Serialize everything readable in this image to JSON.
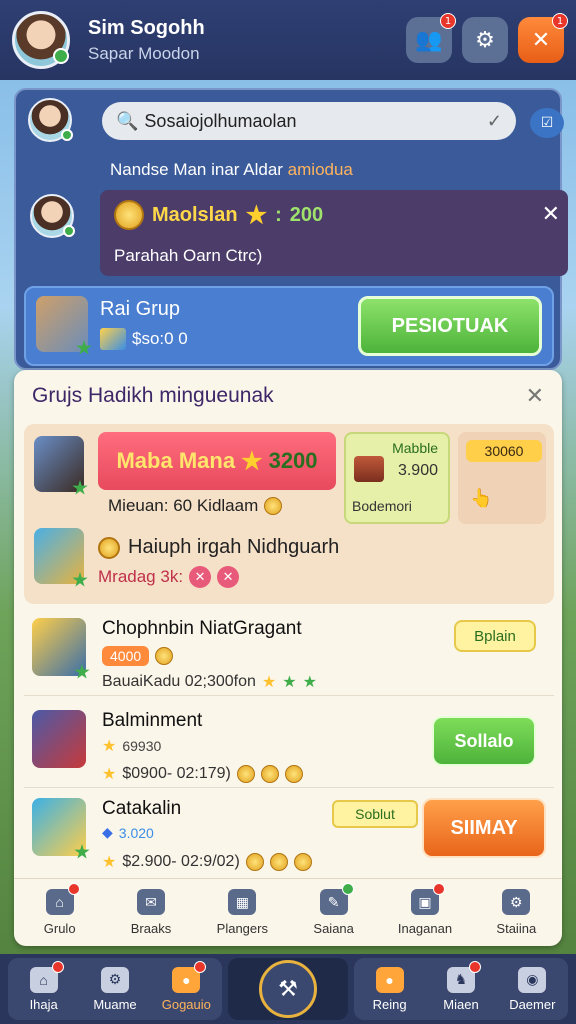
{
  "header": {
    "name": "Sim Sogohh",
    "subtitle": "Sapar Moodon"
  },
  "panel1": {
    "search_text": "Sosaiojolhumaolan",
    "hint_text": "Nandse Man inar Aldar",
    "hint_highlight": "amiodua",
    "promo": {
      "title": "Maolslan",
      "amount": "200",
      "amount_prefix": ":",
      "subtitle": "Parahah Oarn Ctrc)"
    },
    "group": {
      "title": "Rai Grup",
      "stat": "$so:0 0",
      "button": "PESIOTUAK"
    }
  },
  "panel2": {
    "title": "Grujs Hadikh mingueunak",
    "featured": {
      "pink_label": "Maba Mana",
      "pink_amount": "3200",
      "sub_text": "Mieuan: 60 Kidlaam",
      "green_box": {
        "line1": "Mabble",
        "line2": "3.900",
        "line3": "Bodemori"
      },
      "orange_box": {
        "label": "30060"
      },
      "second_title": "Haiuph irgah Nidhguarh",
      "second_sub": "Mradag 3k:"
    },
    "items": [
      {
        "name": "Chophnbin NiatGragant",
        "pill": "4000",
        "stat": "BauaiKadu 02;300fon",
        "button": "Bplain"
      },
      {
        "name": "Balminment",
        "line2": "69930",
        "stat": "$0900- 02:179)",
        "button": "Sollalo"
      },
      {
        "name": "Catakalin",
        "line2": "3.020",
        "stat": "$2.900- 02:9/02)",
        "tag_button": "Soblut",
        "button": "SIIMAY"
      }
    ],
    "tabs": [
      "Grulo",
      "Braaks",
      "Plangers",
      "Saiana",
      "Inaganan",
      "Staiina"
    ]
  },
  "bottom_nav": {
    "left": [
      "Ihaja",
      "Muame",
      "Gogauio"
    ],
    "right": [
      "Reing",
      "Miaen",
      "Daemer"
    ]
  }
}
